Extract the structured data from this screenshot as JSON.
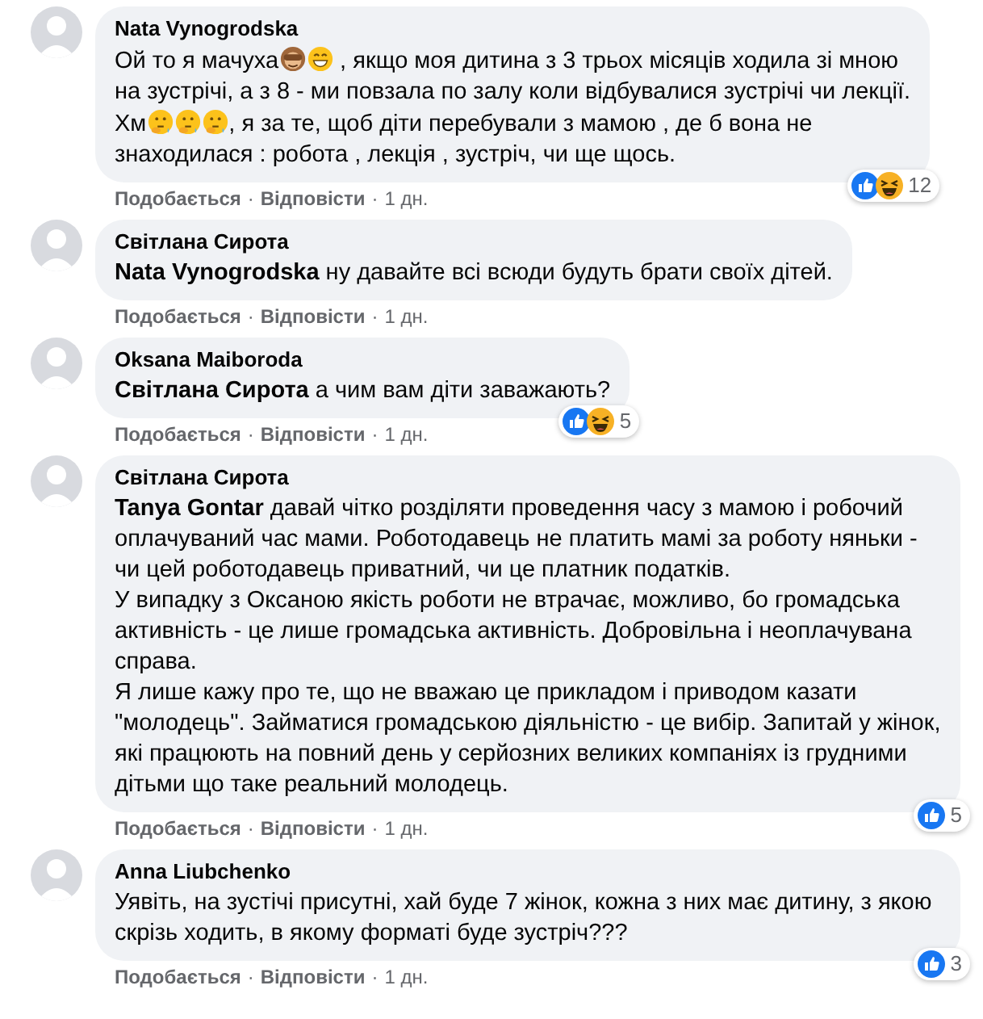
{
  "comments": [
    {
      "author": "Nata Vynogrodska",
      "body": [
        {
          "kind": "text",
          "text": "Ой то я мачуха"
        },
        {
          "kind": "monkey"
        },
        {
          "kind": "grin"
        },
        {
          "kind": "text",
          "text": " , якщо моя дитина з 3 трьох місяців ходила зі мною"
        },
        {
          "kind": "break"
        },
        {
          "kind": "text",
          "text": "на зустрічі, а з 8 - ми повзала по залу коли відбувалися зустрічі чи лекції."
        },
        {
          "kind": "break"
        },
        {
          "kind": "text",
          "text": "Хм"
        },
        {
          "kind": "thinking"
        },
        {
          "kind": "thinking"
        },
        {
          "kind": "thinking"
        },
        {
          "kind": "text",
          "text": ", я за те, щоб діти перебували з мамою , де б вона не"
        },
        {
          "kind": "break"
        },
        {
          "kind": "text",
          "text": "знаходилася : робота , лекція , зустріч, чи ще щось."
        }
      ],
      "reactions": {
        "icons": [
          {
            "kind": "like"
          },
          {
            "kind": "haha"
          }
        ],
        "count": "12"
      },
      "actions": {
        "like": "Подобається",
        "separator": "·",
        "reply": "Відповісти",
        "time": "1 дн."
      }
    },
    {
      "author": "Світлана Сирота",
      "body": [
        {
          "kind": "text",
          "text": "**Nata Vynogrodska** ну давайте всі всюди будуть брати своїх дітей."
        }
      ],
      "actions": {
        "like": "Подобається",
        "separator": "·",
        "reply": "Відповісти",
        "time": "1 дн."
      }
    },
    {
      "author": "Oksana Maiboroda",
      "body": [
        {
          "kind": "text",
          "text": "**Світлана Сирота** а чим вам діти заважають?"
        }
      ],
      "reactions": {
        "icons": [
          {
            "kind": "like"
          },
          {
            "kind": "haha"
          }
        ],
        "count": "5"
      },
      "actions": {
        "like": "Подобається",
        "separator": "·",
        "reply": "Відповісти",
        "time": "1 дн."
      }
    },
    {
      "author": "Світлана Сирота",
      "body": [
        {
          "kind": "text",
          "text": "**Tanya Gontar** давай чітко розділяти проведення часу з мамою і робочий оплачуваний час мами. Роботодавець не платить мамі за роботу няньки - чи цей роботодавець приватний, чи це платник податків."
        },
        {
          "kind": "break"
        },
        {
          "kind": "text",
          "text": "У випадку з Оксаною якість роботи не втрачає, можливо, бо громадська активність - це лише громадська активність. Добровільна і неоплачувана справа."
        },
        {
          "kind": "break"
        },
        {
          "kind": "text",
          "text": "Я лише кажу про те, що не вважаю це прикладом і приводом казати \"молодець\". Займатися громадською діяльністю - це вибір. Запитай у жінок, які працюють на повний день у серйозних великих компаніях із грудними дітьми що таке реальний молодець."
        }
      ],
      "reactions": {
        "icons": [
          {
            "kind": "like"
          }
        ],
        "count": "5"
      },
      "actions": {
        "like": "Подобається",
        "separator": "·",
        "reply": "Відповісти",
        "time": "1 дн."
      }
    },
    {
      "author": "Anna Liubchenko",
      "body": [
        {
          "kind": "text",
          "text": "Уявіть, на зустічі присутні, хай буде 7 жінок, кожна з них має дитину, з якою скрізь ходить, в якому форматі буде зустріч???"
        }
      ],
      "reactions": {
        "icons": [
          {
            "kind": "like"
          }
        ],
        "count": "3"
      },
      "actions": {
        "like": "Подобається",
        "separator": "·",
        "reply": "Відповісти",
        "time": "1 дн."
      }
    }
  ]
}
